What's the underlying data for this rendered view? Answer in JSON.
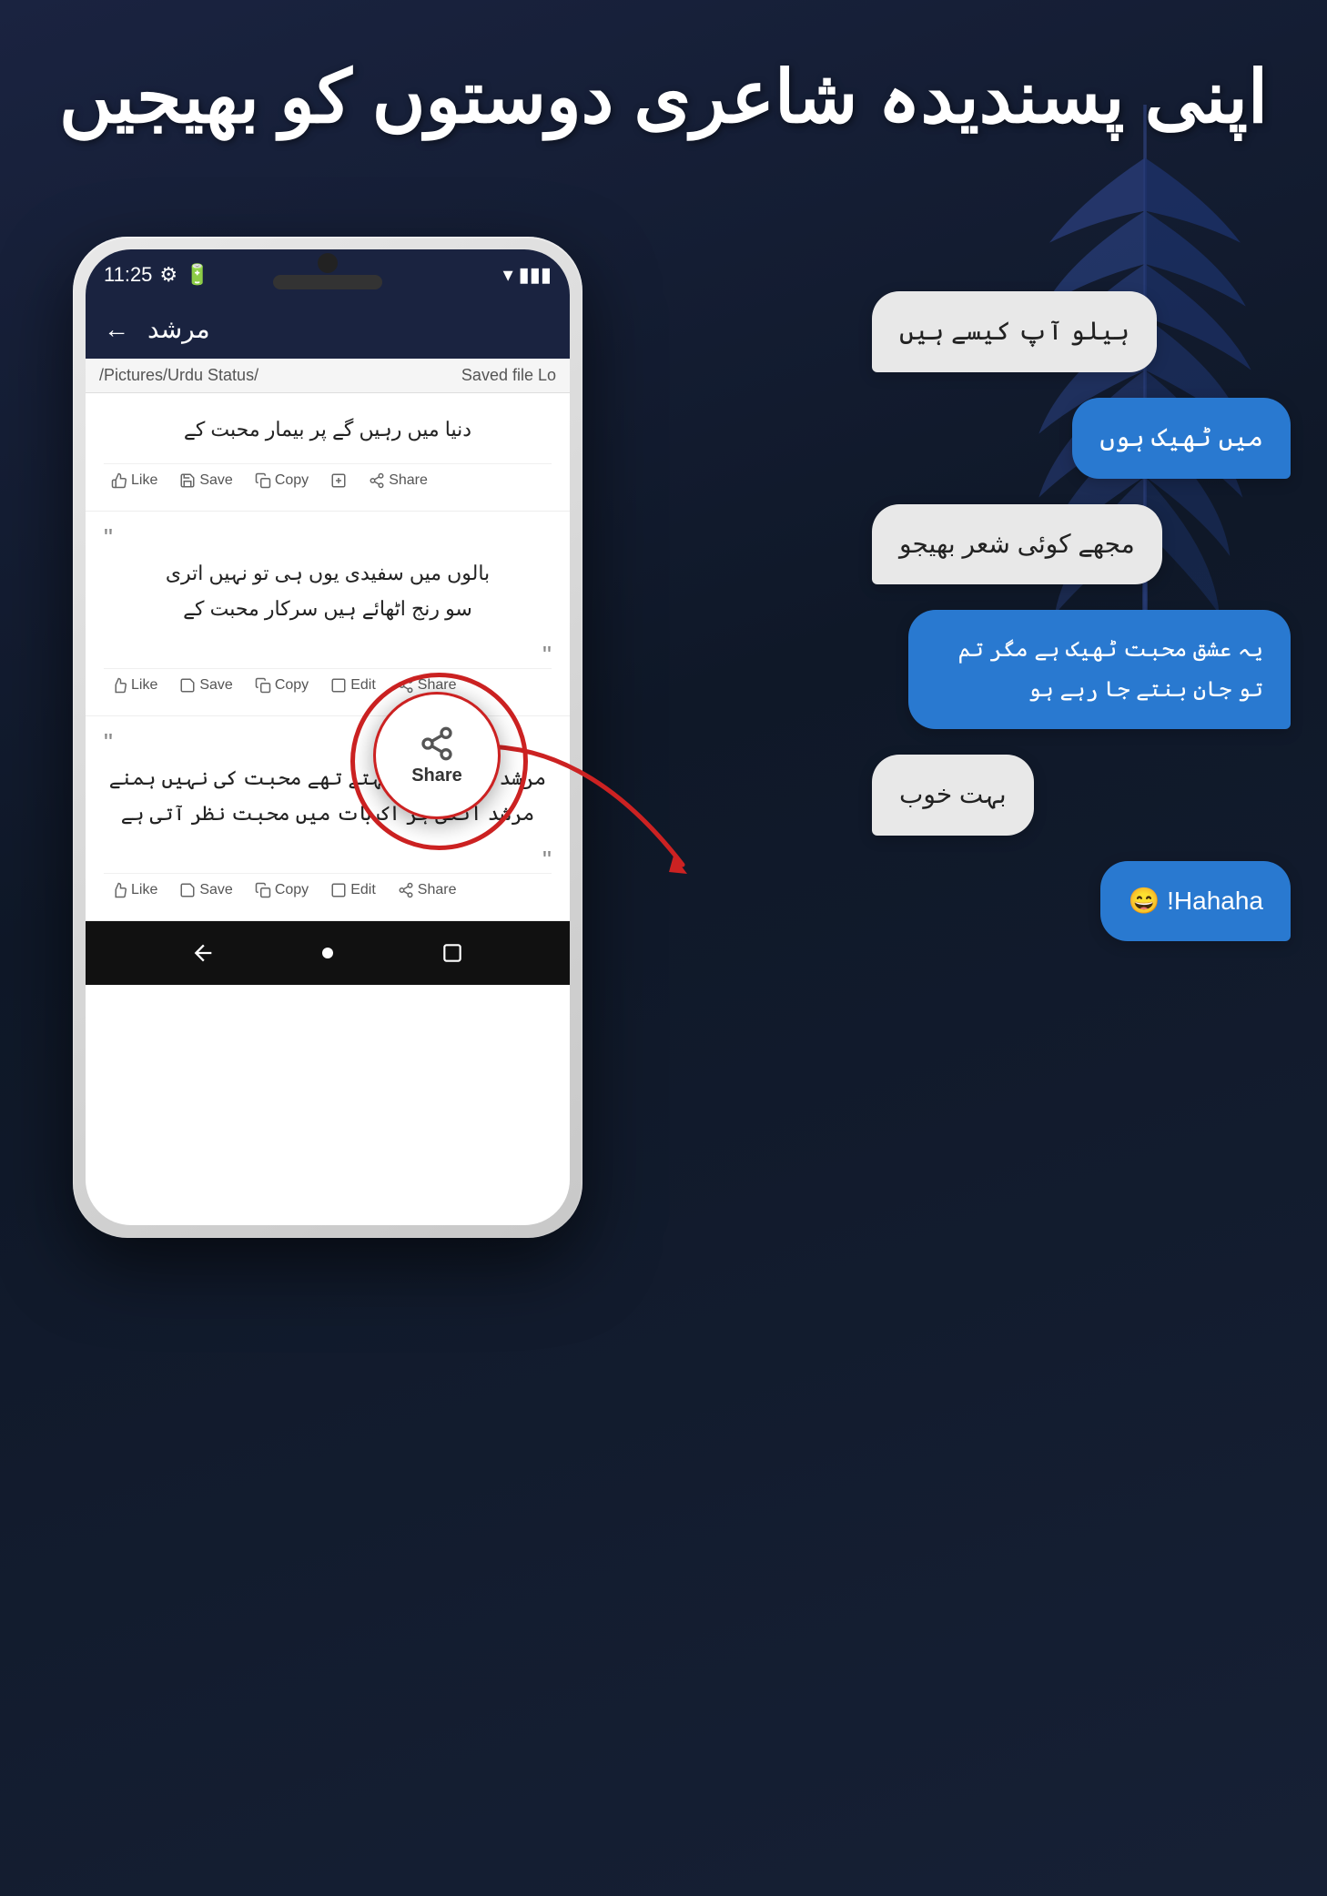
{
  "page": {
    "background": "#1a2340",
    "header_urdu": "اپنی پسندیدہ شاعری دوستوں کو بھیجیں"
  },
  "phone": {
    "status_bar": {
      "time": "11:25",
      "battery": "▮"
    },
    "app_header": {
      "back": "←",
      "title": "مرشد"
    },
    "path_bar": {
      "path": "/Pictures/Urdu Status/",
      "saved": "Saved file Lo"
    },
    "poetry_cards": [
      {
        "id": 1,
        "text": "دنیا میں رہیں گے پر بیمار محبت کے",
        "actions": [
          "Like",
          "Save",
          "Copy",
          "Edit",
          "Share"
        ]
      },
      {
        "id": 2,
        "text_line1": "بالوں میں سفیدی یوں ہی تو نہیں اتری",
        "text_line2": "سو رنج اٹھائے ہیں سرکار محبت کے",
        "actions": [
          "Like",
          "Save",
          "Copy",
          "Edit",
          "Share"
        ]
      },
      {
        "id": 3,
        "text_line1": "مرشد وہ مجھ سے کہتے تھے محبت کی نہیں ہمنے",
        "text_line2": "مرشد انکی ہر اک بات میں محبت نظر آتی ہے",
        "actions": [
          "Like",
          "Save",
          "Copy",
          "Edit",
          "Share"
        ]
      }
    ],
    "share_popup": {
      "text": "Share"
    }
  },
  "chat": {
    "messages": [
      {
        "id": 1,
        "type": "received",
        "text": "ہیلو آپ کیسے ہیں"
      },
      {
        "id": 2,
        "type": "sent",
        "text": "میں ٹھیک ہوں"
      },
      {
        "id": 3,
        "type": "received",
        "text": "مجھے کوئی شعر بھیجو"
      },
      {
        "id": 4,
        "type": "sent",
        "text": "یہ عشق محبت ٹھیک ہے مگر\nتم تو جان بنتے جا رہے ہو"
      },
      {
        "id": 5,
        "type": "received",
        "text": "بہت خوب"
      },
      {
        "id": 6,
        "type": "sent",
        "text": "Hahaha! 😄"
      }
    ]
  },
  "action_labels": {
    "like": "Like",
    "save": "Save",
    "copy": "Copy",
    "edit": "Edit",
    "share": "Share"
  }
}
